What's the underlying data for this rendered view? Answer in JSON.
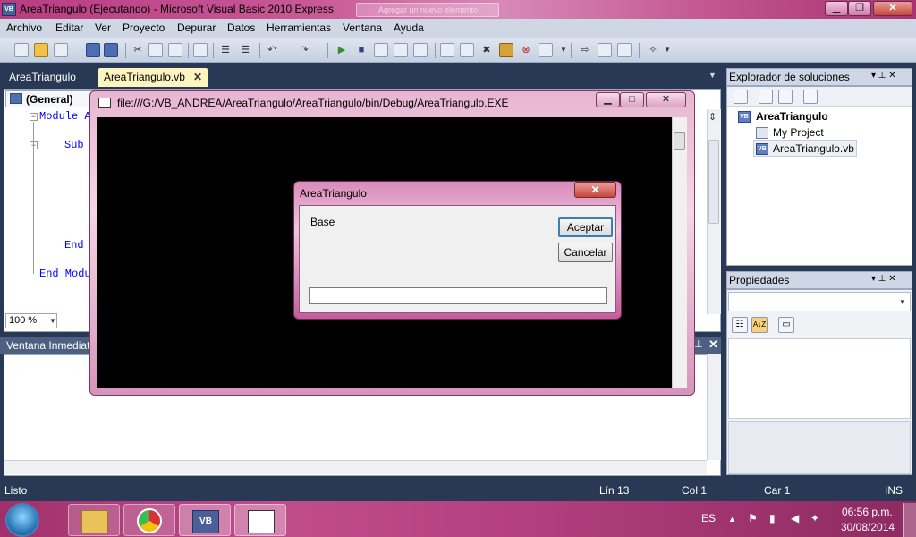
{
  "window": {
    "title": "AreaTriangulo (Ejecutando) - Microsoft Visual Basic 2010 Express",
    "icon_text": "VB",
    "background_tab": "Agregar un nuevo elemento",
    "min_glyph": "▁",
    "max_glyph": "❐",
    "close_glyph": "✕"
  },
  "menu": [
    "Archivo",
    "Editar",
    "Ver",
    "Proyecto",
    "Depurar",
    "Datos",
    "Herramientas",
    "Ventana",
    "Ayuda"
  ],
  "document_tabs": {
    "inactive": "AreaTriangulo",
    "active": "AreaTriangulo.vb",
    "close_glyph": "✕",
    "dropdown_glyph": "▼"
  },
  "editor": {
    "general_combo": "(General)",
    "lines": [
      "Module A",
      "Sub",
      "End",
      "End Modu"
    ],
    "fold_minus": "−",
    "zoom": "100 %",
    "zoom_arrow": "▼",
    "split_glyph": "⇕"
  },
  "immediate": {
    "title": "Ventana Inmediato",
    "pin_glyph": "⊥",
    "close_glyph": "✕"
  },
  "solution_explorer": {
    "title": "Explorador de soluciones",
    "pin_glyph": "▾ ⊥ ✕",
    "project": "AreaTriangulo",
    "my_project": "My Project",
    "file": "AreaTriangulo.vb"
  },
  "properties": {
    "title": "Propiedades",
    "pin_glyph": "▾ ⊥ ✕",
    "combo_arrow": "▼",
    "sort_label": "A↓Z"
  },
  "console": {
    "title": "file:///G:/VB_ANDREA/AreaTriangulo/AreaTriangulo/bin/Debug/AreaTriangulo.EXE",
    "min_glyph": "▁",
    "max_glyph": "□",
    "close_glyph": "✕"
  },
  "dialog": {
    "title": "AreaTriangulo",
    "close_glyph": "✕",
    "prompt": "Base",
    "ok_label": "Aceptar",
    "cancel_label": "Cancelar",
    "input_value": ""
  },
  "status": {
    "ready": "Listo",
    "line": "Lín 13",
    "col": "Col 1",
    "char": "Car 1",
    "mode": "INS"
  },
  "taskbar": {
    "language": "ES",
    "tray_arrow": "▲",
    "time": "06:56 p.m.",
    "date": "30/08/2014",
    "vb_label": "VB"
  },
  "colors": {
    "ide_dark": "#293955",
    "active_tab": "#fdf4bf",
    "aero_pink": "#c04d8c",
    "code_keyword": "#0000ff"
  }
}
